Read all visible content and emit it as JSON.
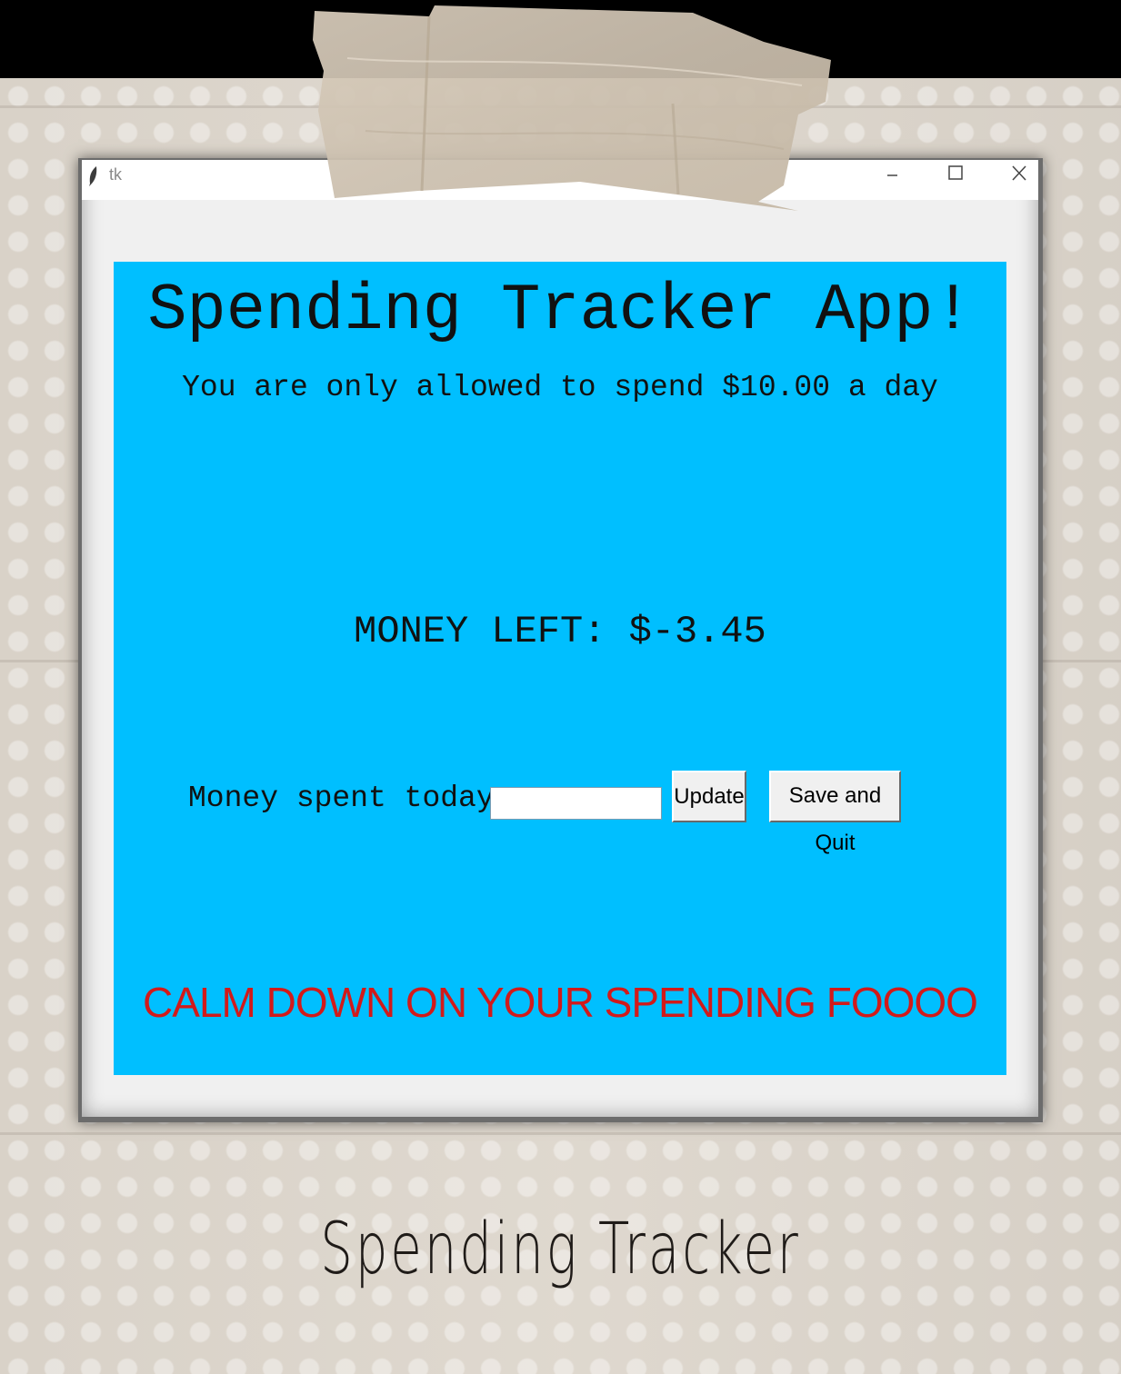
{
  "window": {
    "title": "tk",
    "controls": [
      "minimize-icon",
      "maximize-icon",
      "close-icon"
    ]
  },
  "app": {
    "title": "Spending Tracker App!",
    "subtitle": "You are only allowed to spend $10.00 a day",
    "money_left": "MONEY LEFT: $-3.45",
    "spent_label": "Money spent today:",
    "spent_input_value": "",
    "update_label": "Update",
    "save_quit_label": "Save and Quit",
    "warning": "CALM DOWN ON YOUR SPENDING FOOOO"
  },
  "caption": "Spending Tracker",
  "colors": {
    "app_background": "#00bfff",
    "warning_text": "#d21a1a",
    "paper": "#ddd6cc",
    "tape": "#cfc2b0"
  }
}
